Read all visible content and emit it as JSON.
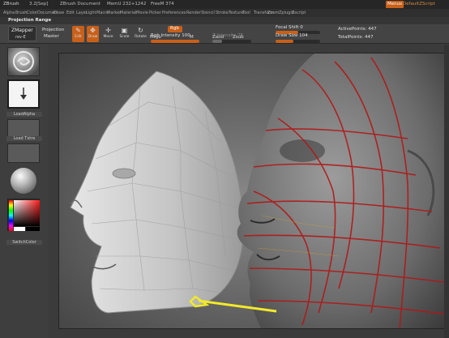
{
  "titlebar": {
    "app": "ZBrush",
    "version": "3.2[Sep]",
    "document": "ZBrush Document",
    "mem": "MemU 232+1242",
    "free": "FreeM 374",
    "menus_button": "Menus",
    "default_script": "DefaultZScript"
  },
  "menubar": {
    "items": [
      "Alpha",
      "Brush",
      "Color",
      "Document",
      "Draw",
      "Edit",
      "Layer",
      "Light",
      "Macro",
      "Marker",
      "Material",
      "Movie",
      "Picker",
      "Preferences",
      "Render",
      "Stencil",
      "Stroke",
      "Texture",
      "Tool",
      "Transform",
      "Zoom",
      "Zplugin",
      "Zscript"
    ]
  },
  "palette": {
    "title": "Projection Range"
  },
  "toolbar": {
    "zmapper_label": "ZMapper",
    "zmapper_version": "rev-E",
    "projection_master_1": "Projection",
    "projection_master_2": "Master",
    "edit_label": "Edit",
    "draw_label": "Draw",
    "move_label": "Move",
    "scale_label": "Scale",
    "rotate_label": "Rotate",
    "mrgb_label": "Mrgb",
    "rgb_label": "Rgb",
    "m_label": "M",
    "rgb_intensity_label": "Rgb Intensity",
    "rgb_intensity_value": "100",
    "zadd_label": "Zadd",
    "zsub_label": "Zsub",
    "z_intensity_label": "Z Intensity",
    "z_intensity_value": "25",
    "focal_shift_label": "Focal Shift",
    "focal_shift_value": "0",
    "draw_size_label": "Draw Size",
    "draw_size_value": "104",
    "active_points": "ActivePoints: 447",
    "total_points": "TotalPoints: 447",
    "rgb_intensity_fraction": 1.0,
    "z_intensity_fraction": 0.25,
    "focal_shift_fraction": 0.5,
    "draw_size_fraction": 0.4
  },
  "leftshelf": {
    "alpha_label": "LoadAlpha",
    "texture_label": "Load Txtre",
    "switch_color": "SwitchColor"
  },
  "colors": {
    "accent": "#c8601a",
    "wire": "#b01818",
    "pointer_line": "#f2ea2a"
  }
}
